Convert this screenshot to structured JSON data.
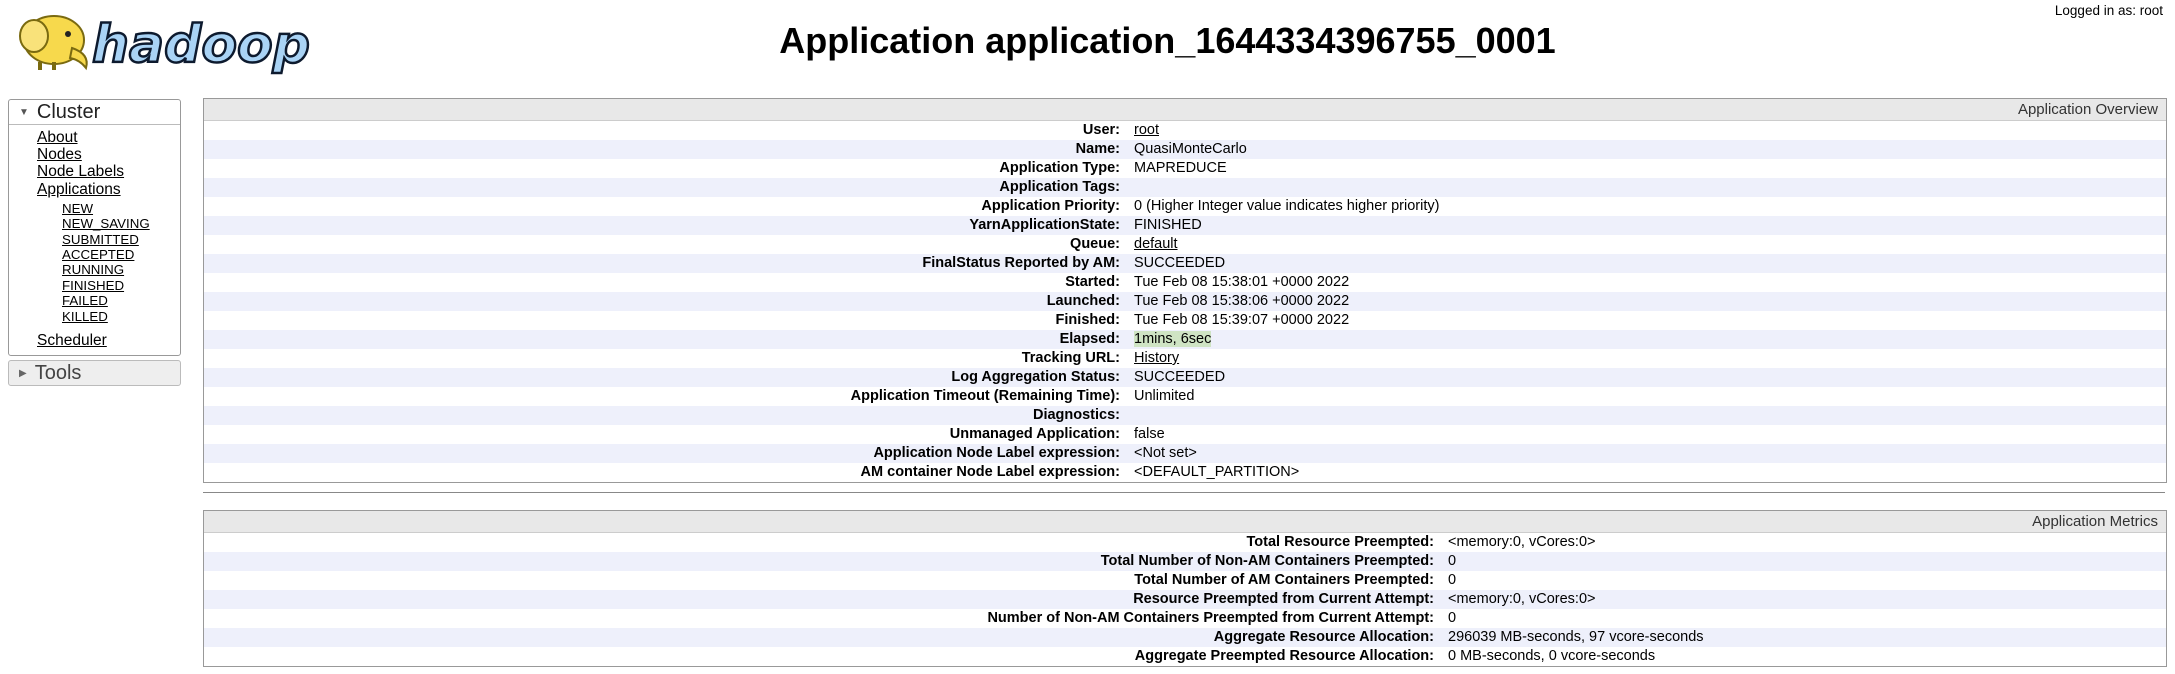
{
  "header": {
    "logo_text": "hadoop",
    "title": "Application application_1644334396755_0001",
    "logged_in": "Logged in as: root"
  },
  "sidebar": {
    "cluster_label": "Cluster",
    "links": [
      {
        "label": "About"
      },
      {
        "label": "Nodes"
      },
      {
        "label": "Node Labels"
      },
      {
        "label": "Applications"
      }
    ],
    "app_states": [
      {
        "label": "NEW"
      },
      {
        "label": "NEW_SAVING"
      },
      {
        "label": "SUBMITTED"
      },
      {
        "label": "ACCEPTED"
      },
      {
        "label": "RUNNING"
      },
      {
        "label": "FINISHED"
      },
      {
        "label": "FAILED"
      },
      {
        "label": "KILLED"
      }
    ],
    "scheduler_label": "Scheduler",
    "tools_label": "Tools"
  },
  "overview": {
    "title": "Application Overview",
    "rows": [
      {
        "key": "User:",
        "value": "root"
      },
      {
        "key": "Name:",
        "value": "QuasiMonteCarlo"
      },
      {
        "key": "Application Type:",
        "value": "MAPREDUCE"
      },
      {
        "key": "Application Tags:",
        "value": ""
      },
      {
        "key": "Application Priority:",
        "value": "0 (Higher Integer value indicates higher priority)"
      },
      {
        "key": "YarnApplicationState:",
        "value": "FINISHED"
      },
      {
        "key": "Queue:",
        "value": "default"
      },
      {
        "key": "FinalStatus Reported by AM:",
        "value": "SUCCEEDED"
      },
      {
        "key": "Started:",
        "value": "Tue Feb 08 15:38:01 +0000 2022"
      },
      {
        "key": "Launched:",
        "value": "Tue Feb 08 15:38:06 +0000 2022"
      },
      {
        "key": "Finished:",
        "value": "Tue Feb 08 15:39:07 +0000 2022"
      },
      {
        "key": "Elapsed:",
        "value": "1mins, 6sec"
      },
      {
        "key": "Tracking URL:",
        "value": "History"
      },
      {
        "key": "Log Aggregation Status:",
        "value": "SUCCEEDED"
      },
      {
        "key": "Application Timeout (Remaining Time):",
        "value": "Unlimited"
      },
      {
        "key": "Diagnostics:",
        "value": ""
      },
      {
        "key": "Unmanaged Application:",
        "value": "false"
      },
      {
        "key": "Application Node Label expression:",
        "value": "<Not set>"
      },
      {
        "key": "AM container Node Label expression:",
        "value": "<DEFAULT_PARTITION>"
      }
    ]
  },
  "metrics": {
    "title": "Application Metrics",
    "rows": [
      {
        "key": "Total Resource Preempted:",
        "value": "<memory:0, vCores:0>"
      },
      {
        "key": "Total Number of Non-AM Containers Preempted:",
        "value": "0"
      },
      {
        "key": "Total Number of AM Containers Preempted:",
        "value": "0"
      },
      {
        "key": "Resource Preempted from Current Attempt:",
        "value": "<memory:0, vCores:0>"
      },
      {
        "key": "Number of Non-AM Containers Preempted from Current Attempt:",
        "value": "0"
      },
      {
        "key": "Aggregate Resource Allocation:",
        "value": "296039 MB-seconds, 97 vcore-seconds"
      },
      {
        "key": "Aggregate Preempted Resource Allocation:",
        "value": "0 MB-seconds, 0 vcore-seconds"
      }
    ]
  },
  "colors": {
    "row_stripe": "#eef0fb",
    "table_header": "#e8e8e8",
    "elapsed_highlight": "#cfe4c4",
    "logo_elephant": "#f7d94c",
    "logo_text_fill": "#a9d3f5"
  }
}
